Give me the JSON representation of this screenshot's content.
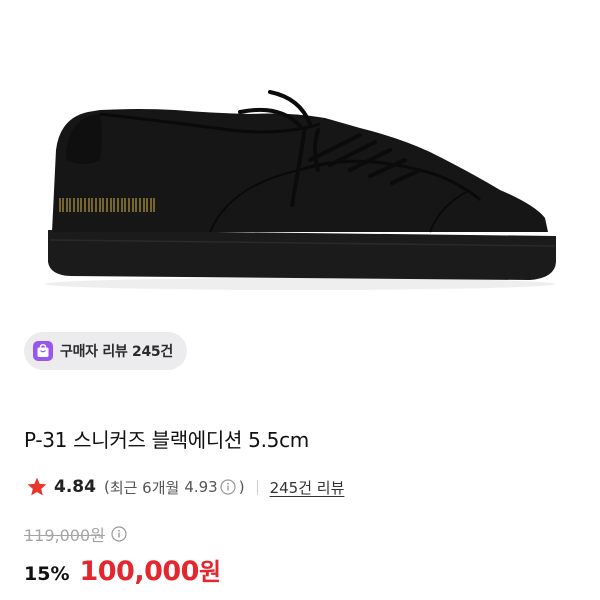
{
  "product": {
    "image_alt": "black low-top leather sneaker with gold serial number on heel",
    "review_chip_label": "구매자 리뷰 245건",
    "title": "P-31 스니커즈 블랙에디션 5.5cm",
    "rating": "4.84",
    "recent_paren_open": "(",
    "recent_label": "최근 6개월",
    "recent_rating": "4.93",
    "recent_paren_close": ")",
    "review_link_label": "245건 리뷰",
    "original_price": "119,000원",
    "discount_rate": "15%",
    "sale_price": "100,000",
    "currency": "원"
  },
  "icons": {
    "chip_icon": "shopping-bag-icon",
    "star_icon": "star-icon",
    "info_icon": "info-icon"
  },
  "colors": {
    "accent_red": "#e4262e",
    "star_red": "#e8352e",
    "chip_purple": "#9a55f0",
    "chip_bg": "#ececef",
    "muted_text": "#a5a5a5"
  }
}
